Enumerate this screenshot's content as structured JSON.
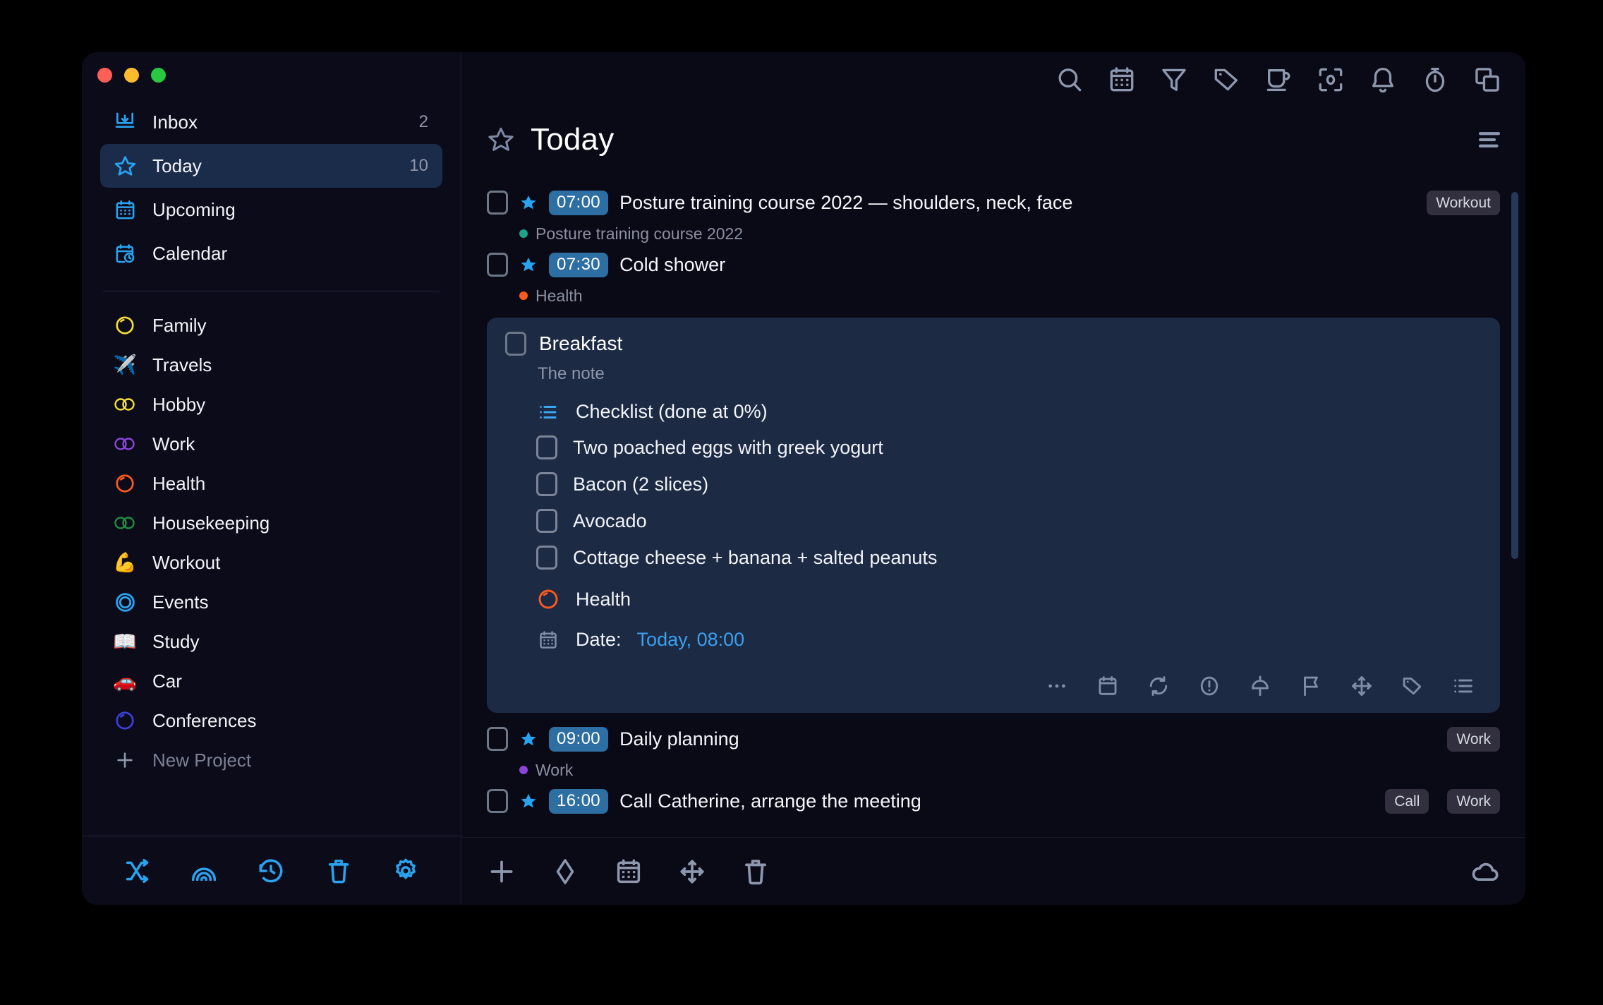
{
  "window": {
    "traffic_lights": [
      "close",
      "minimize",
      "zoom"
    ],
    "colors": {
      "accent": "#29a3ef",
      "window_bg": "#0b0a18",
      "sidebar_bg": "#0c0b1a",
      "card_bg": "#1c2a44",
      "active_nav_bg": "#1b2c4a",
      "time_badge_bg": "#2d6ea3",
      "tag_pill_bg": "#32303f"
    }
  },
  "sidebar": {
    "nav": [
      {
        "label": "Inbox",
        "icon": "inbox-icon",
        "count": "2",
        "active": false
      },
      {
        "label": "Today",
        "icon": "star-icon",
        "count": "10",
        "active": true
      },
      {
        "label": "Upcoming",
        "icon": "calendar-icon",
        "count": "",
        "active": false
      },
      {
        "label": "Calendar",
        "icon": "calendar-clock-icon",
        "count": "",
        "active": false
      }
    ],
    "projects": [
      {
        "label": "Family",
        "icon": "circle-icon",
        "color": "#f5e03a"
      },
      {
        "label": "Travels",
        "icon": "airplane-emoji",
        "color": "#63c4f0"
      },
      {
        "label": "Hobby",
        "icon": "two-circles-icon",
        "color": "#f5e03a"
      },
      {
        "label": "Work",
        "icon": "two-circles-icon",
        "color": "#8b44d6"
      },
      {
        "label": "Health",
        "icon": "circle-icon",
        "color": "#fb5a1e"
      },
      {
        "label": "Housekeeping",
        "icon": "two-circles-icon",
        "color": "#1f8f3e"
      },
      {
        "label": "Workout",
        "icon": "flexed-biceps-emoji",
        "color": "#f0b429"
      },
      {
        "label": "Events",
        "icon": "double-ring-icon",
        "color": "#29a3ef"
      },
      {
        "label": "Study",
        "icon": "open-book-emoji",
        "color": "#cfd6e2"
      },
      {
        "label": "Car",
        "icon": "car-emoji",
        "color": "#e03a2f"
      },
      {
        "label": "Conferences",
        "icon": "circle-icon",
        "color": "#3b3fd6"
      }
    ],
    "new_project_label": "New Project",
    "footer_buttons": [
      {
        "name": "shuffle-icon",
        "label": "Random task"
      },
      {
        "name": "rainbow-arc-icon",
        "label": "Review"
      },
      {
        "name": "history-clock-icon",
        "label": "History"
      },
      {
        "name": "trash-icon",
        "label": "Trash"
      },
      {
        "name": "gear-icon",
        "label": "Settings"
      }
    ]
  },
  "header": {
    "title": "Today",
    "star_icon": "star-outline-icon",
    "menu_icon": "hamburger-menu-icon",
    "toolbar": [
      {
        "name": "search-icon",
        "label": "Search"
      },
      {
        "name": "calendar-icon",
        "label": "Calendar"
      },
      {
        "name": "filter-icon",
        "label": "Filter"
      },
      {
        "name": "tag-icon",
        "label": "Tags"
      },
      {
        "name": "coffee-mug-icon",
        "label": "Break"
      },
      {
        "name": "focus-frame-icon",
        "label": "Focus"
      },
      {
        "name": "bell-icon",
        "label": "Notifications"
      },
      {
        "name": "stopwatch-icon",
        "label": "Timer"
      },
      {
        "name": "split-panels-icon",
        "label": "Panels"
      }
    ]
  },
  "tasks": [
    {
      "checked": false,
      "starred": true,
      "time": "07:00",
      "title": "Posture training course 2022 — shoulders, neck, face",
      "tags": [
        "Workout"
      ],
      "project": "Posture training course 2022",
      "project_color": "#1ea38a"
    },
    {
      "checked": false,
      "starred": true,
      "time": "07:30",
      "title": "Cold shower",
      "tags": [],
      "project": "Health",
      "project_color": "#fb5a1e"
    }
  ],
  "expanded_task": {
    "checked": false,
    "title": "Breakfast",
    "note": "The note",
    "checklist": {
      "icon": "checklist-icon",
      "heading": "Checklist (done at 0%)",
      "items": [
        {
          "label": "Two poached eggs with greek yogurt",
          "checked": false
        },
        {
          "label": "Bacon (2 slices)",
          "checked": false
        },
        {
          "label": "Avocado",
          "checked": false
        },
        {
          "label": "Cottage cheese + banana + salted peanuts",
          "checked": false
        }
      ]
    },
    "project": {
      "label": "Health",
      "color": "#fb5a1e",
      "icon": "circle-icon"
    },
    "date": {
      "prefix": "Date:",
      "value": "Today, 08:00",
      "icon": "calendar-icon"
    },
    "actions": [
      {
        "name": "more-dots-icon",
        "label": "More"
      },
      {
        "name": "calendar-icon",
        "label": "Date"
      },
      {
        "name": "repeat-icon",
        "label": "Repeat"
      },
      {
        "name": "priority-icon",
        "label": "Priority"
      },
      {
        "name": "pin-icon",
        "label": "Pin"
      },
      {
        "name": "flag-icon",
        "label": "Flag"
      },
      {
        "name": "move-arrows-icon",
        "label": "Move"
      },
      {
        "name": "tag-icon",
        "label": "Tag"
      },
      {
        "name": "checklist-icon",
        "label": "Checklist"
      }
    ]
  },
  "tasks_after": [
    {
      "checked": false,
      "starred": true,
      "time": "09:00",
      "title": "Daily planning",
      "tags": [
        "Work"
      ],
      "project": "Work",
      "project_color": "#8b44d6"
    },
    {
      "checked": false,
      "starred": true,
      "time": "16:00",
      "title": "Call Catherine, arrange the meeting",
      "tags": [
        "Call",
        "Work"
      ],
      "project": "",
      "project_color": ""
    }
  ],
  "bottom_toolbar": {
    "left": [
      {
        "name": "plus-icon",
        "label": "New task"
      },
      {
        "name": "diamond-tag-icon",
        "label": "New label"
      },
      {
        "name": "calendar-icon",
        "label": "Date"
      },
      {
        "name": "move-arrows-icon",
        "label": "Move"
      },
      {
        "name": "trash-icon",
        "label": "Delete"
      }
    ],
    "right": [
      {
        "name": "cloud-sync-icon",
        "label": "Sync"
      }
    ]
  }
}
